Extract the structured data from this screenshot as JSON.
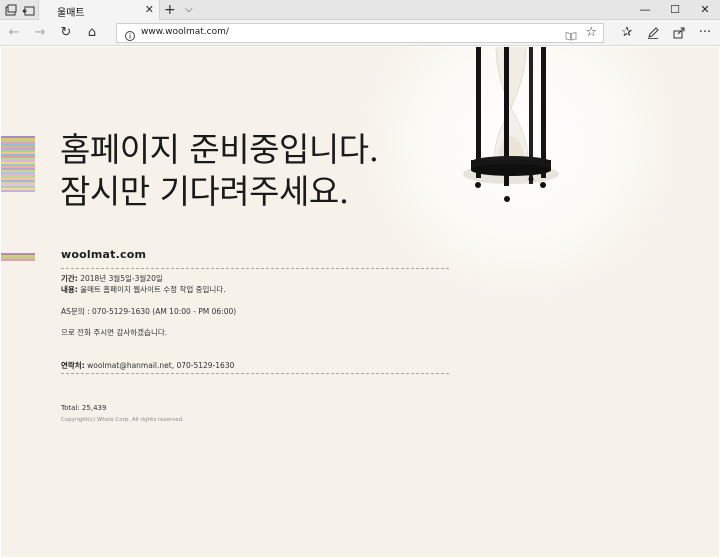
{
  "browser": {
    "tab_title": "울매트",
    "tab_close": "✕",
    "new_tab": "+",
    "tab_menu": "⌵",
    "window_buttons": {
      "minimize": "—",
      "maximize": "☐",
      "close": "✕"
    },
    "nav": {
      "back": "←",
      "forward": "→",
      "refresh": "↻",
      "home": "⌂",
      "favorites_hub": "✰",
      "more": "···"
    },
    "address_url": "www.woolmat.com/",
    "favorite_star": "☆"
  },
  "page": {
    "heading_line1": "홈페이지 준비중입니다.",
    "heading_line2": "잠시만 기다려주세요.",
    "site_name": "woolmat.com",
    "period_label": "기간:",
    "period_value": "2018년 3월5일-3월20일",
    "content_label": "내용:",
    "content_value": "울매트 홈페이지 웹사이트 수정 작업 중입니다.",
    "as_line": "AS문의 : 070-5129-1630 (AM 10:00 - PM 06:00)",
    "thanks_line": "으로 전화 주시면 감사하겠습니다.",
    "contact_label": "연락처:",
    "contact_value": "woolmat@hanmail.net, 070-5129-1630",
    "total": "Total: 25,439",
    "copyright": "Copyright(c) Whois Corp. All rights reserved."
  },
  "stripe_colors": {
    "top": [
      "#9e8fc4",
      "#e6c46d",
      "#b7d38a",
      "#e3a1b8",
      "#8fc0d8",
      "#d9b38c",
      "#c5a3d3",
      "#a8cf9e",
      "#f0c98a",
      "#96b6d9",
      "#e0a39a",
      "#bcd4a0",
      "#d4b8e0",
      "#f1d38f",
      "#9fc7c2",
      "#e8b0a6",
      "#b5a7d6",
      "#d6cf8e",
      "#a6c9e3",
      "#e5b6c9",
      "#c2d69b",
      "#f2c7a0",
      "#a9b6dc",
      "#d9d0a8",
      "#e8c1e0",
      "#b0d0b5",
      "#f0dca0",
      "#c9b2d8"
    ],
    "bottom": [
      "#9e8fc4",
      "#e6c46d",
      "#b7d38a",
      "#e3a1b8"
    ]
  }
}
